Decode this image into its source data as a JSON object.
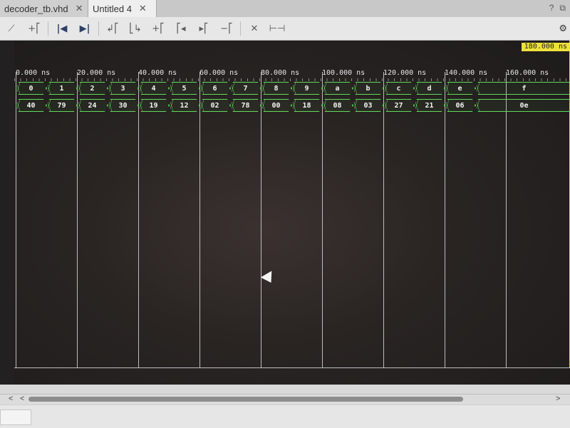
{
  "tabs": [
    {
      "label": "decoder_tb.vhd",
      "close": "✕"
    },
    {
      "label": "Untitled 4",
      "close": "✕"
    }
  ],
  "tab_actions": {
    "help": "?",
    "restore": "⧉"
  },
  "toolbar": {
    "icons": [
      "zoom-fit-icon",
      "add-marker-icon",
      "go-to-start-icon",
      "go-to-end-icon",
      "previous-transition-icon",
      "next-transition-icon",
      "add-marker-2-icon",
      "previous-marker-icon",
      "next-marker-icon",
      "swap-cursors-icon",
      "delete-icon",
      "fit-width-icon"
    ],
    "glyphs": [
      "⟋",
      "+⎡",
      "|◀",
      "▶|",
      "↲⎡",
      "⎣↳",
      "+⎡",
      "⎡◂",
      "▸⎡",
      "−⎡",
      "✕",
      "⊢⊣"
    ]
  },
  "cursor_time": "180.000 ns",
  "ruler": {
    "labels": [
      "0.000 ns",
      "20.000 ns",
      "40.000 ns",
      "60.000 ns",
      "80.000 ns",
      "100.000 ns",
      "120.000 ns",
      "140.000 ns",
      "160.000 ns"
    ]
  },
  "signals": [
    {
      "values": [
        "0",
        "1",
        "2",
        "3",
        "4",
        "5",
        "6",
        "7",
        "8",
        "9",
        "a",
        "b",
        "c",
        "d",
        "e",
        "f"
      ]
    },
    {
      "values": [
        "40",
        "79",
        "24",
        "30",
        "19",
        "12",
        "02",
        "78",
        "00",
        "18",
        "08",
        "03",
        "27",
        "21",
        "06",
        "0e"
      ]
    }
  ],
  "colors": {
    "bus": "#62d95b",
    "cursor": "#f0e13a",
    "background": "#221f1f"
  }
}
